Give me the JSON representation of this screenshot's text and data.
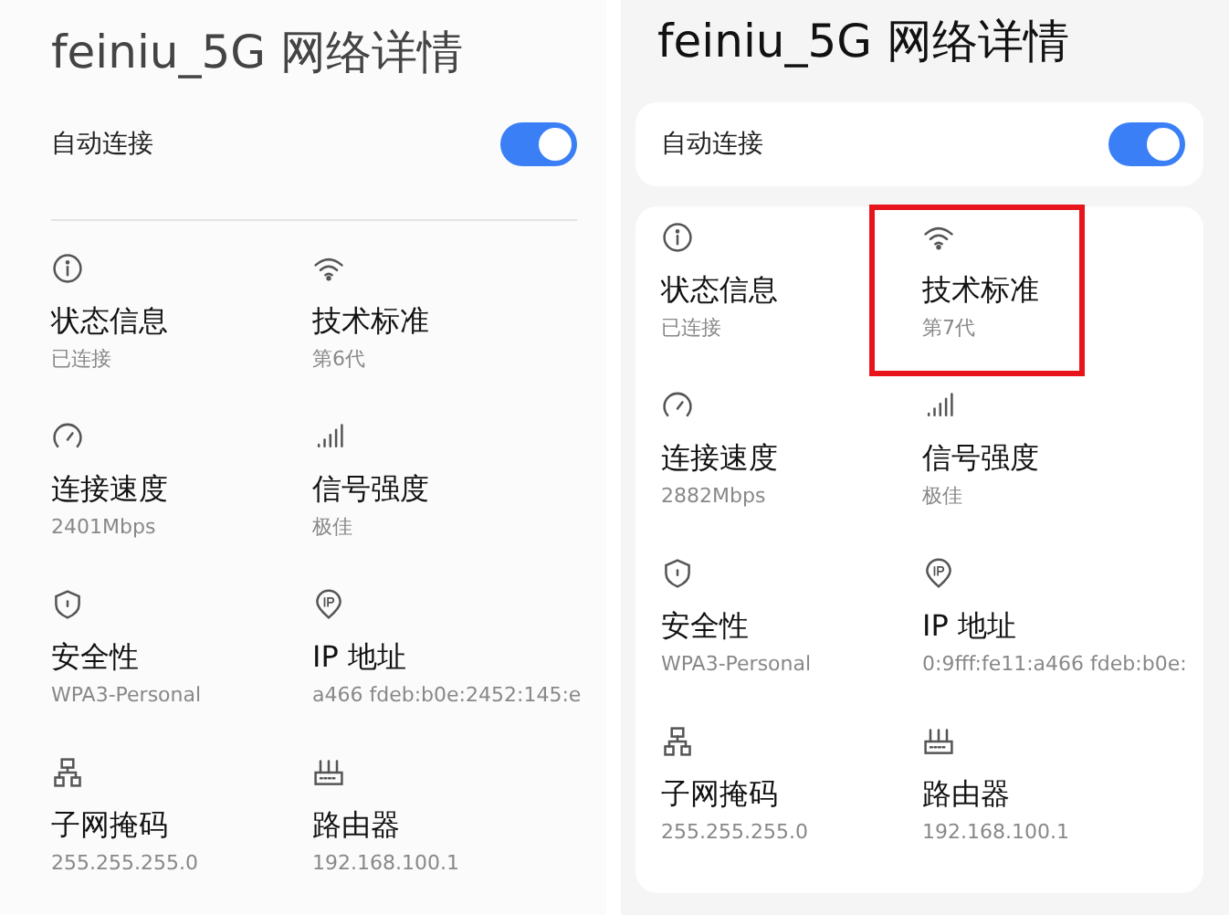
{
  "panels": [
    {
      "kind": "plain",
      "title": "feiniu_5G 网络详情",
      "auto_connect": {
        "label": "自动连接",
        "on": true
      },
      "items": [
        {
          "kind": "info",
          "label": "状态信息",
          "value": "已连接",
          "highlighted": false
        },
        {
          "kind": "wifi",
          "label": "技术标准",
          "value": "第6代",
          "highlighted": false
        },
        {
          "kind": "gauge",
          "label": "连接速度",
          "value": "2401Mbps",
          "highlighted": false
        },
        {
          "kind": "signal",
          "label": "信号强度",
          "value": "极佳",
          "highlighted": false
        },
        {
          "kind": "shield",
          "label": "安全性",
          "value": "WPA3-Personal",
          "highlighted": false
        },
        {
          "kind": "ip",
          "label": "IP 地址",
          "value": "a466 fdeb:b0e:2452:145:e",
          "highlighted": false
        },
        {
          "kind": "subnet",
          "label": "子网掩码",
          "value": "255.255.255.0",
          "highlighted": false
        },
        {
          "kind": "router",
          "label": "路由器",
          "value": "192.168.100.1",
          "highlighted": false
        }
      ]
    },
    {
      "kind": "cards",
      "title": "feiniu_5G 网络详情",
      "auto_connect": {
        "label": "自动连接",
        "on": true
      },
      "items": [
        {
          "kind": "info",
          "label": "状态信息",
          "value": "已连接",
          "highlighted": false
        },
        {
          "kind": "wifi",
          "label": "技术标准",
          "value": "第7代",
          "highlighted": true
        },
        {
          "kind": "gauge",
          "label": "连接速度",
          "value": "2882Mbps",
          "highlighted": false
        },
        {
          "kind": "signal",
          "label": "信号强度",
          "value": "极佳",
          "highlighted": false
        },
        {
          "kind": "shield",
          "label": "安全性",
          "value": "WPA3-Personal",
          "highlighted": false
        },
        {
          "kind": "ip",
          "label": "IP 地址",
          "value": "0:9fff:fe11:a466 fdeb:b0e:",
          "highlighted": false
        },
        {
          "kind": "subnet",
          "label": "子网掩码",
          "value": "255.255.255.0",
          "highlighted": false
        },
        {
          "kind": "router",
          "label": "路由器",
          "value": "192.168.100.1",
          "highlighted": false
        }
      ]
    }
  ]
}
